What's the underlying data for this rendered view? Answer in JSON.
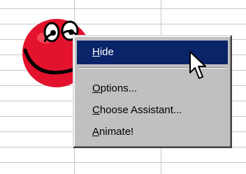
{
  "context_menu": {
    "items": [
      {
        "label": "Hide",
        "accel": "H",
        "rest": "ide"
      },
      {
        "label": "Options...",
        "accel": "O",
        "rest": "ptions..."
      },
      {
        "label": "Choose Assistant...",
        "accel": "C",
        "rest": "hoose Assistant..."
      },
      {
        "label": "Animate!",
        "accel": "A",
        "rest": "nimate!"
      }
    ],
    "highlighted_item": "Hide"
  },
  "assistant": {
    "icon": "smiley-assistant-icon"
  },
  "cursor": {
    "icon": "arrow-cursor-icon"
  }
}
